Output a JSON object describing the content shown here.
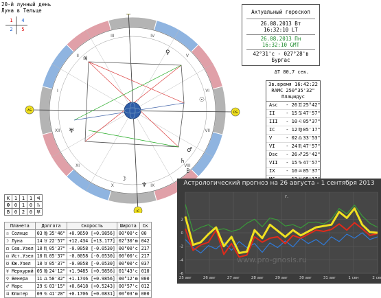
{
  "header": {
    "lunar_day": "20-й лунный день",
    "moon_sign": "Луна в Тельце"
  },
  "quadrant": {
    "q1": "1",
    "q2": "4",
    "q3": "2",
    "q4": "5",
    "west": "3",
    "east": "1",
    "south": "S"
  },
  "horoscope": {
    "title": "Актуальный гороскоп",
    "local_date": "26.08.2013 Вт",
    "local_time": "16:32:10 LT",
    "gmt_date": "26.08.2013 Пн",
    "gmt_time": "16:32:10 GMT",
    "coords": "42°31'с - 027°28'в",
    "city": "Бургас"
  },
  "delta_t": "ΔT 80,7 сек.",
  "houses_table": {
    "header": [
      "Зв.время 16:42:22",
      "RAMC 250°35'32\"",
      "Плацидус"
    ],
    "rows": [
      {
        "label": "Asc",
        "num": "26",
        "sign": "♊",
        "deg": "25°42\""
      },
      {
        "label": "II",
        "num": "15",
        "sign": "♋",
        "deg": "47'57\""
      },
      {
        "label": "III",
        "num": "10",
        "sign": "♌",
        "deg": "05°37\""
      },
      {
        "label": "IC",
        "num": "12",
        "sign": "♍",
        "deg": "05'17\""
      },
      {
        "label": "V",
        "num": "02",
        "sign": "♎",
        "deg": "33'53\""
      },
      {
        "label": "VI",
        "num": "24",
        "sign": "♏",
        "deg": "47'57\""
      },
      {
        "label": "Dsc",
        "num": "26",
        "sign": "♐",
        "deg": "25'42\""
      },
      {
        "label": "VII",
        "num": "15",
        "sign": "♑",
        "deg": "47'57\""
      },
      {
        "label": "IX",
        "num": "10",
        "sign": "♒",
        "deg": "05'37\""
      },
      {
        "label": "MC",
        "num": "12",
        "sign": "♓",
        "deg": "05'17\""
      },
      {
        "label": "XI",
        "num": "02",
        "sign": "♈",
        "deg": "33'53\""
      },
      {
        "label": "XII",
        "num": "24",
        "sign": "♉",
        "deg": "47'57\""
      }
    ]
  },
  "aspect_table": {
    "rows": [
      [
        "К",
        "1",
        "1",
        "1"
      ],
      [
        "Ф",
        "0",
        "1",
        "0"
      ],
      [
        "В",
        "0",
        "2",
        "0"
      ]
    ],
    "row_symbols": [
      "♃",
      "♄",
      "♅"
    ]
  },
  "planets_table": {
    "headers": [
      "Планета",
      "Долгота",
      "Скорость",
      "Широта",
      "Ск"
    ],
    "rows": [
      {
        "name": "☉ Солнце",
        "num": "03",
        "sign": "♍",
        "deg": "35'46\"",
        "speed": "+0.9650 [+0.9856]",
        "lat": "00°00'с",
        "extra": "00"
      },
      {
        "name": "☽ Луна",
        "num": "14",
        "sign": "♉",
        "deg": "22'57\"",
        "speed": "+12.434 [+13.177]",
        "lat": "02°30'ю",
        "extra": "042"
      },
      {
        "name": "☊ Сев.Узел",
        "num": "10",
        "sign": "♏",
        "deg": "05'37\"",
        "speed": "-0.0058 [-0.0530]",
        "lat": "00°00'с",
        "extra": "217"
      },
      {
        "name": "☊ Ист.Узел",
        "num": "10",
        "sign": "♏",
        "deg": "05'37\"",
        "speed": "-0.0058 [-0.0530]",
        "lat": "00°00'с",
        "extra": "217"
      },
      {
        "name": "☋ Юж.Узел",
        "num": "10",
        "sign": "♉",
        "deg": "05'37\"",
        "speed": "-0.0058 [-0.0530]",
        "lat": "00°00'с",
        "extra": "037"
      },
      {
        "name": "☿ Меркурий",
        "num": "05",
        "sign": "♍",
        "deg": "24'12\"",
        "speed": "+1.9485 [+0.9856]",
        "lat": "01°43'с",
        "extra": "010"
      },
      {
        "name": "♀ Венера",
        "num": "11",
        "sign": "♎",
        "deg": "50'32\"",
        "speed": "+1.1746 [+0.9856]",
        "lat": "00°12'ю",
        "extra": "000"
      },
      {
        "name": "♂ Марс",
        "num": "29",
        "sign": "♋",
        "deg": "03'15\"",
        "speed": "+0.6418 [+0.5243]",
        "lat": "00°57'с",
        "extra": "012"
      },
      {
        "name": "♃ Юпитер",
        "num": "09",
        "sign": "♋",
        "deg": "41'28\"",
        "speed": "+0.1706 [+0.0831]",
        "lat": "00°03'ю",
        "extra": "000"
      }
    ]
  },
  "wheel": {
    "house_numerals": [
      "I",
      "II",
      "III",
      "IV",
      "V",
      "VI",
      "VII",
      "VIII",
      "IX",
      "X",
      "XI",
      "XII"
    ],
    "asc_label": "AS",
    "dsc_label": "DS",
    "mc_label": "MC",
    "ic_label": "IC",
    "colors": {
      "red": "#e0a0a8",
      "blue": "#8fb4e0",
      "grey": "#b4b4b4"
    }
  },
  "chart_data": {
    "type": "line",
    "title": "Астрологический прогноз на 26 августа  - 1 сентября 2013",
    "xlabel": "г.",
    "categories": [
      "25 авг",
      "26 авг",
      "27 авг",
      "28 авг",
      "29 авг",
      "30 авг",
      "31 авг",
      "1 сен",
      "2 сен"
    ],
    "ylim": [
      -6,
      6
    ],
    "yticks": [
      "2",
      "0",
      "-2",
      "-4",
      "-6"
    ],
    "series": [
      {
        "color": "#f0e020",
        "values": [
          2.4,
          -1.8,
          -1.4,
          -0.2,
          0.8,
          -2.0,
          -0.6,
          -3.0,
          -2.8,
          0.4,
          -0.8,
          1.2,
          0.3,
          -0.6,
          0.4,
          -0.4,
          0.2,
          0.8,
          1.0,
          1.2,
          3.1,
          2.2,
          3.6,
          1.2,
          0.1,
          0.0
        ]
      },
      {
        "color": "#3a9a3a",
        "values": [
          4.2,
          0.2,
          0.8,
          1.2,
          0.4,
          0.6,
          0.2,
          0.5,
          1.4,
          2.0,
          0.9,
          2.2,
          1.9,
          1.0,
          1.2,
          0.7,
          1.5,
          1.6,
          1.3,
          2.0,
          3.6,
          2.8,
          4.1,
          2.5,
          1.4,
          0.8
        ]
      },
      {
        "color": "#e02a1a",
        "values": [
          0.6,
          -2.6,
          -1.8,
          -1.4,
          0.4,
          -3.2,
          -1.6,
          -3.6,
          -3.3,
          -0.6,
          -1.4,
          -0.8,
          -0.6,
          -1.6,
          -0.4,
          -0.8,
          -0.2,
          0.4,
          0.2,
          0.5,
          1.3,
          0.4,
          1.5,
          0.6,
          -0.4,
          -0.1
        ]
      },
      {
        "color": "#2f7ad8",
        "values": [
          -1.0,
          -2.2,
          -3.0,
          -1.9,
          -2.4,
          -1.4,
          -2.6,
          -1.3,
          -2.2,
          -1.6,
          -2.9,
          -1.5,
          -2.2,
          -1.2,
          -2.1,
          -0.8,
          -1.6,
          -1.0,
          -1.8,
          -0.6,
          -1.3,
          -0.2,
          -0.8,
          0.0,
          -1.0,
          -0.6
        ]
      }
    ],
    "watermark": "www.pro-gnosis.ru"
  }
}
